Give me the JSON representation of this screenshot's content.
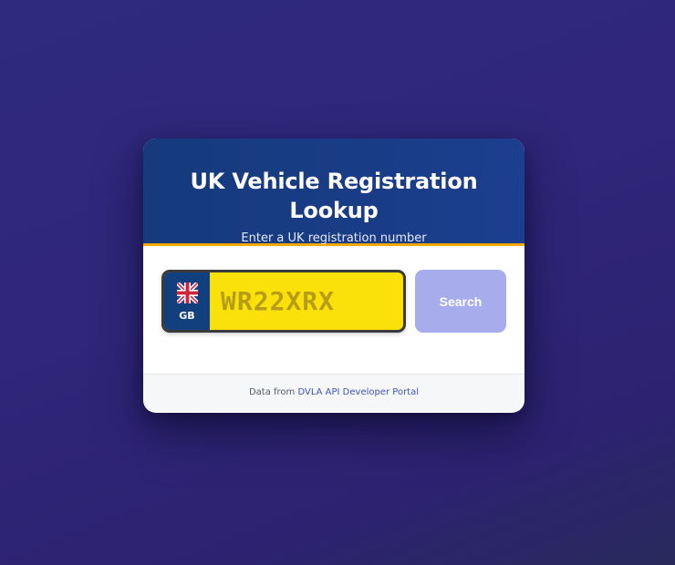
{
  "header": {
    "title": "UK Vehicle Registration Lookup",
    "subtitle": "Enter a UK registration number"
  },
  "plate": {
    "country_code": "GB",
    "flag_icon": "union-jack-icon",
    "placeholder": "WR22XRX",
    "value": ""
  },
  "search": {
    "label": "Search"
  },
  "footer": {
    "prefix": "Data from",
    "link_text": "DVLA API Developer Portal"
  },
  "colors": {
    "header_bg": "#1c3e8e",
    "accent_stripe": "#f2a900",
    "plate_yellow": "#fbe10a",
    "badge_blue": "#12407e",
    "button_disabled": "#a6acec",
    "link": "#3d54b8"
  }
}
